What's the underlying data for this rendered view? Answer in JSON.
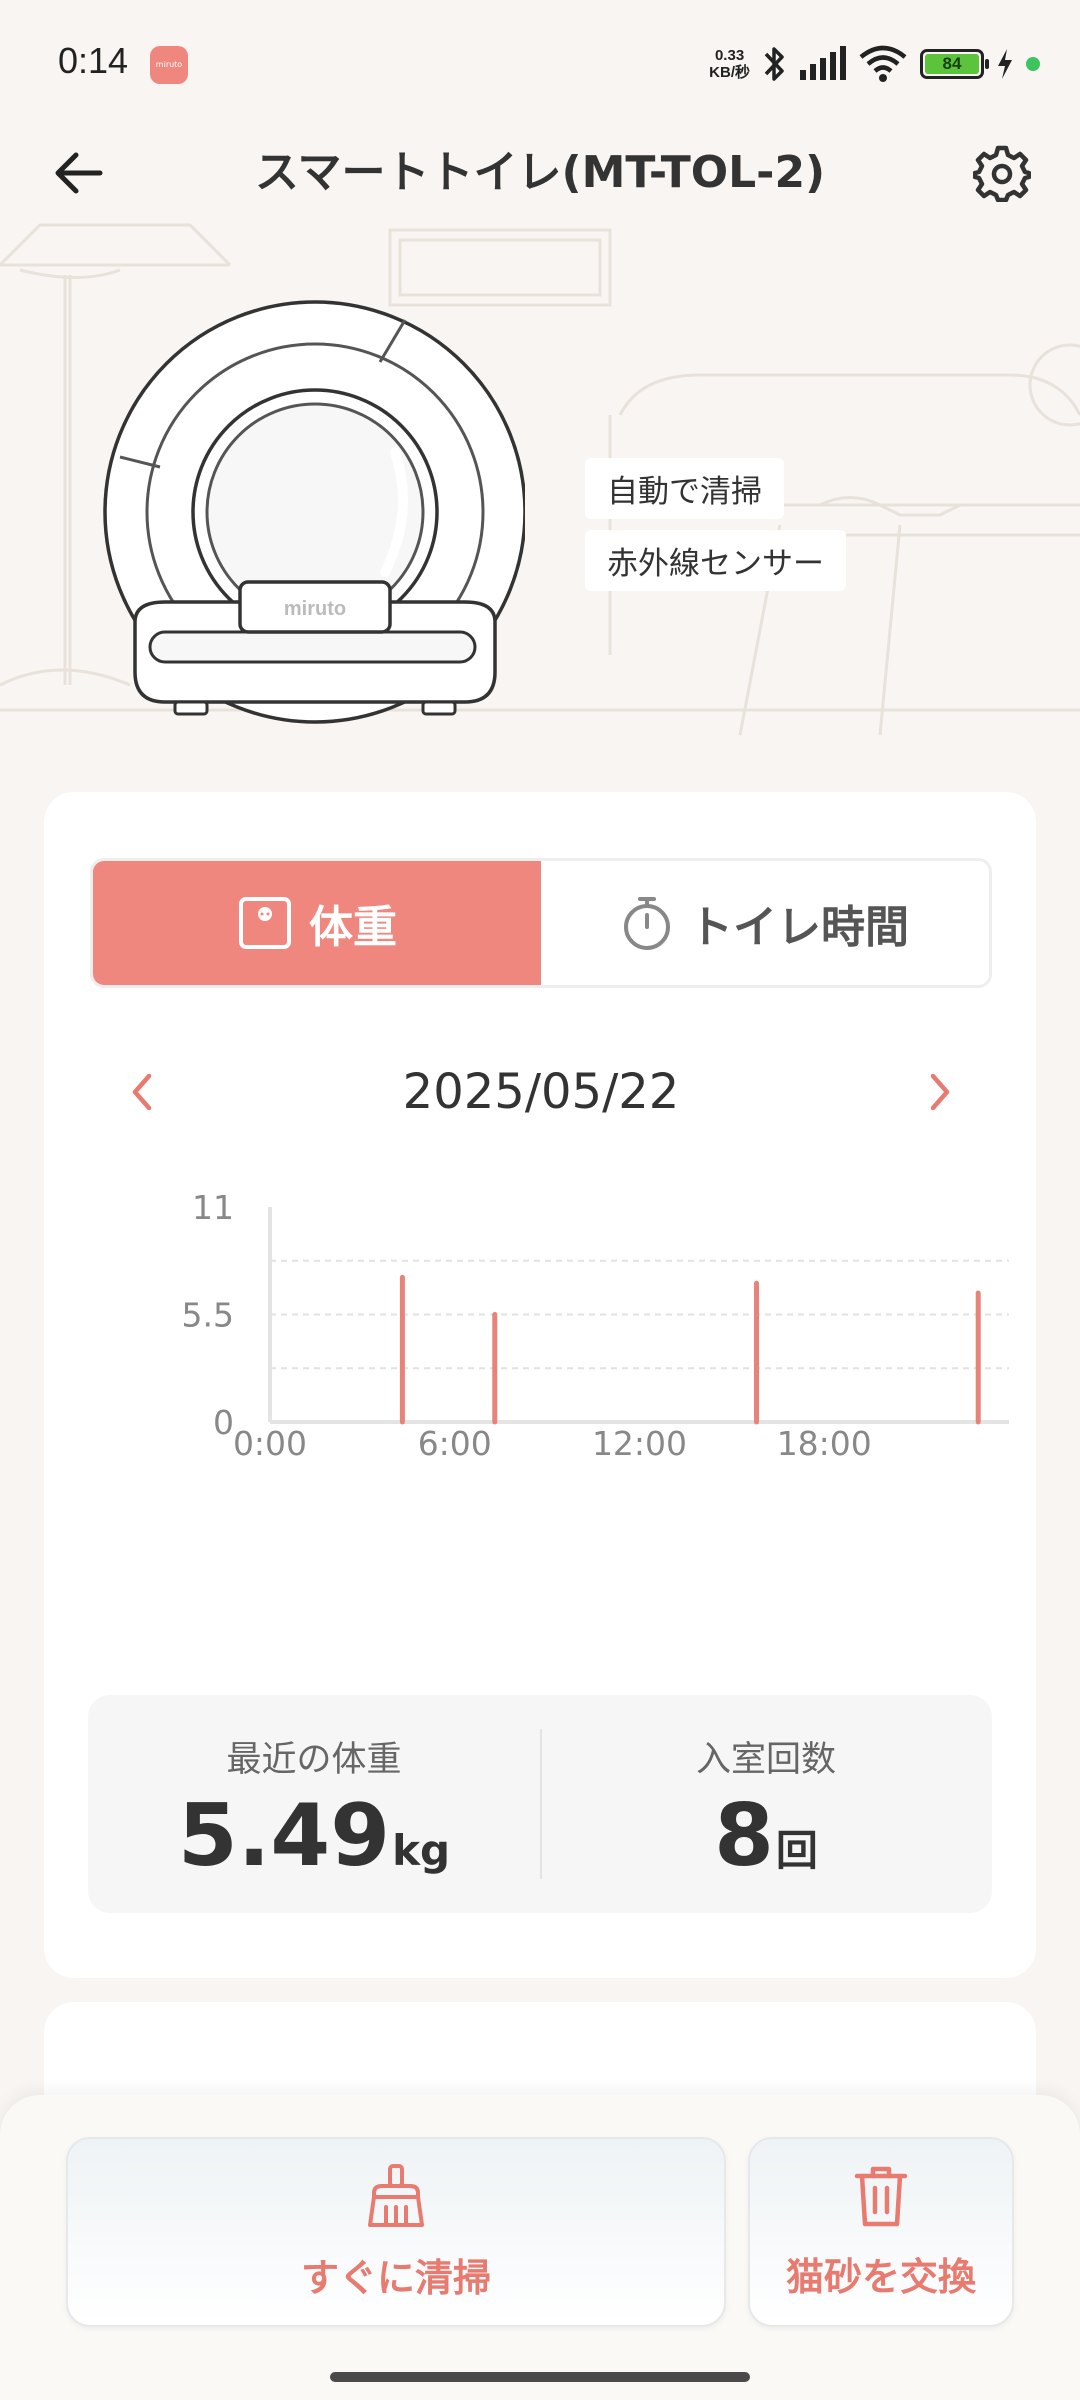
{
  "status_bar": {
    "time": "0:14",
    "app_icon_text": "miruto",
    "net_speed_value": "0.33",
    "net_speed_unit": "KB/秒",
    "battery": "84",
    "icons": [
      "bluetooth-icon",
      "signal-icon",
      "wifi-icon",
      "charging-icon"
    ]
  },
  "header": {
    "title": "スマートトイレ(MT-TOL-2)",
    "back_icon": "arrow-left-icon",
    "settings_icon": "gear-icon"
  },
  "hero": {
    "product_brand": "miruto",
    "features": [
      "自動で清掃",
      "赤外線センサー"
    ]
  },
  "tabs": [
    {
      "label": "体重",
      "icon": "scale-icon",
      "active": true
    },
    {
      "label": "トイレ時間",
      "icon": "stopwatch-icon",
      "active": false
    }
  ],
  "date_nav": {
    "date": "2025/05/22",
    "prev_icon": "chevron-left-icon",
    "next_icon": "chevron-right-icon"
  },
  "chart_data": {
    "type": "bar",
    "title": "",
    "xlabel": "",
    "ylabel": "",
    "ylim": [
      0,
      11
    ],
    "xlim": [
      0,
      24
    ],
    "y_ticks": [
      "11",
      "5.5",
      "0"
    ],
    "y_tick_values": [
      11,
      5.5,
      0
    ],
    "x_ticks": [
      "0:00",
      "6:00",
      "12:00",
      "18:00"
    ],
    "x_tick_values": [
      0,
      6,
      12,
      18
    ],
    "grid": true,
    "color": "#e8837a",
    "points": [
      {
        "hour": 4.3,
        "value": 7.4
      },
      {
        "hour": 7.3,
        "value": 5.5
      },
      {
        "hour": 15.8,
        "value": 7.1
      },
      {
        "hour": 23.0,
        "value": 6.6
      }
    ]
  },
  "stats": [
    {
      "label": "最近の体重",
      "value": "5.49",
      "unit": "kg"
    },
    {
      "label": "入室回数",
      "value": "8",
      "unit": "回"
    }
  ],
  "actions": [
    {
      "label": "すぐに清掃",
      "icon": "broom-icon"
    },
    {
      "label": "猫砂を交換",
      "icon": "trash-icon"
    }
  ],
  "colors": {
    "accent": "#f0877e",
    "background": "#f8f5f2",
    "text": "#333333"
  }
}
